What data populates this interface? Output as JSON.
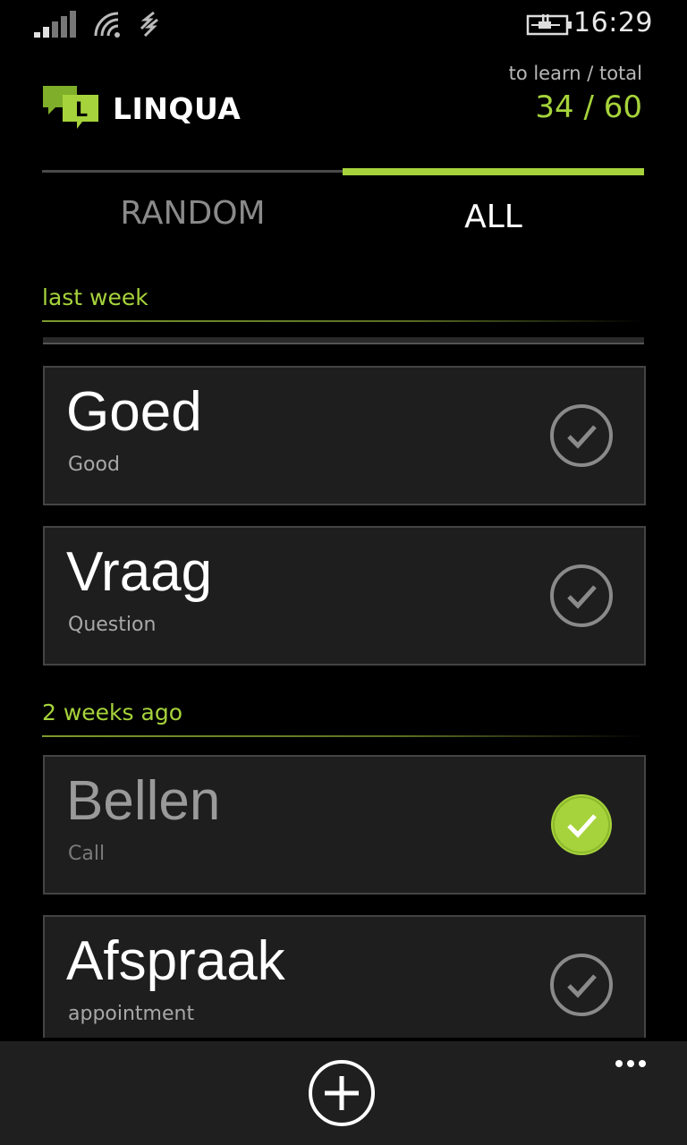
{
  "status_bar": {
    "time": "16:29",
    "icons": [
      "signal-icon",
      "wifi-icon",
      "sync-icon",
      "battery-charging-icon"
    ]
  },
  "header": {
    "app_name": "LINQUA",
    "logo_letter": "L",
    "stats_label": "to learn / total",
    "stats_value": "34 / 60"
  },
  "tabs": [
    {
      "label": "RANDOM",
      "active": false
    },
    {
      "label": "ALL",
      "active": true
    }
  ],
  "colors": {
    "accent": "#a6d33b",
    "background": "#000000",
    "card": "#1e1e1e",
    "app_bar": "#1f1f1f"
  },
  "groups": [
    {
      "title": "last week",
      "cards": [
        {
          "word": "Goed",
          "translation": "Good",
          "learned": false
        },
        {
          "word": "Vraag",
          "translation": "Question",
          "learned": false
        }
      ]
    },
    {
      "title": "2 weeks ago",
      "cards": [
        {
          "word": "Bellen",
          "translation": "Call",
          "learned": true
        },
        {
          "word": "Afspraak",
          "translation": "appointment",
          "learned": false
        }
      ]
    }
  ],
  "app_bar": {
    "add_icon": "plus-circle-icon",
    "more_icon": "ellipsis-icon"
  }
}
